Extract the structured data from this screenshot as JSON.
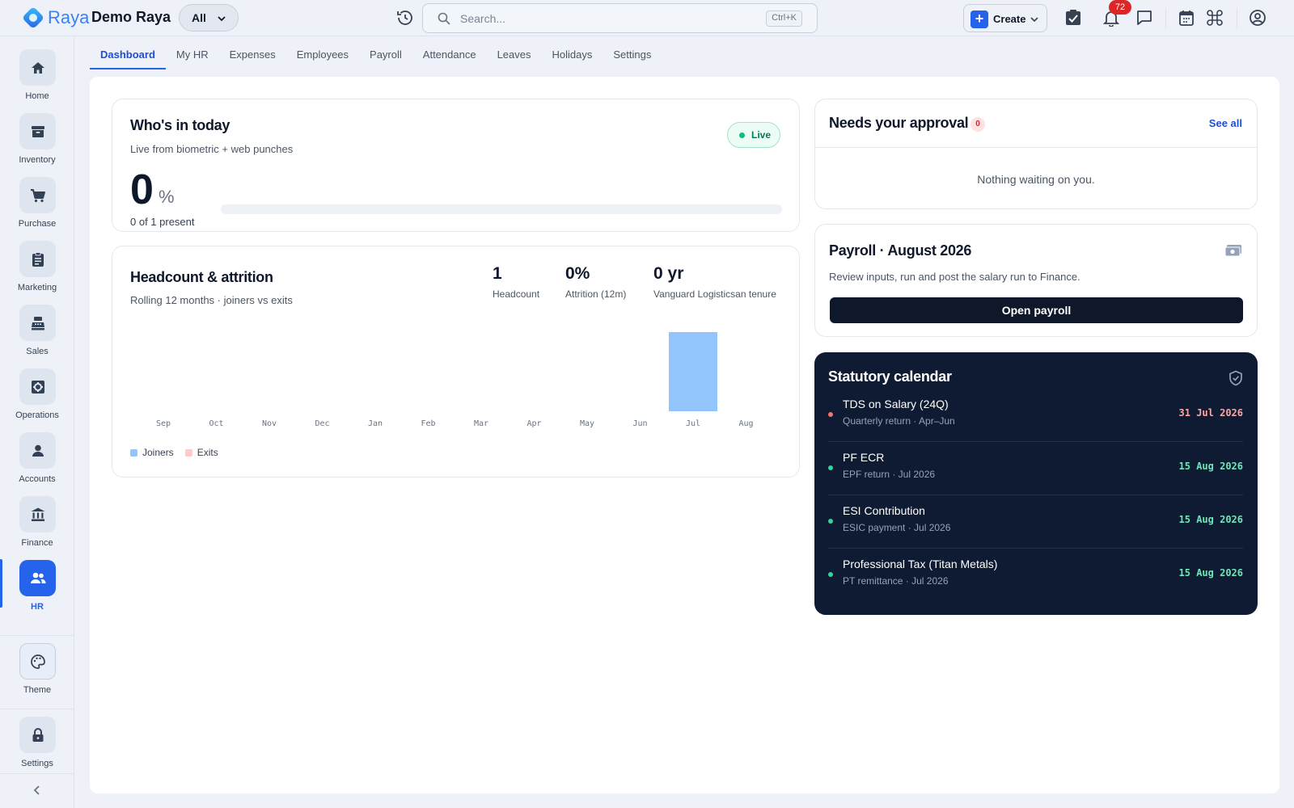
{
  "header": {
    "brand": "Raya",
    "company": "Demo Raya",
    "scope": "All",
    "search_placeholder": "Search...",
    "search_shortcut": "Ctrl+K",
    "create_label": "Create",
    "notification_count": "72"
  },
  "sidebar": {
    "items": [
      {
        "label": "Home",
        "icon": "home-icon"
      },
      {
        "label": "Inventory",
        "icon": "archive-icon"
      },
      {
        "label": "Purchase",
        "icon": "cart-icon"
      },
      {
        "label": "Marketing",
        "icon": "clipboard-icon"
      },
      {
        "label": "Sales",
        "icon": "cash-register-icon"
      },
      {
        "label": "Operations",
        "icon": "cog-icon"
      },
      {
        "label": "Accounts",
        "icon": "user-icon"
      },
      {
        "label": "Finance",
        "icon": "bank-icon"
      },
      {
        "label": "HR",
        "icon": "people-icon"
      }
    ],
    "active": "HR",
    "theme_label": "Theme",
    "settings_label": "Settings"
  },
  "tabs": [
    "Dashboard",
    "My HR",
    "Expenses",
    "Employees",
    "Payroll",
    "Attendance",
    "Leaves",
    "Holidays",
    "Settings"
  ],
  "active_tab": "Dashboard",
  "whos_in": {
    "title": "Who's in today",
    "subtitle": "Live from biometric + web punches",
    "live_label": "Live",
    "percent": "0",
    "percent_sign": "%",
    "present_text": "0 of 1 present",
    "progress_fraction": 0
  },
  "headcount": {
    "title": "Headcount & attrition",
    "subtitle": "Rolling 12 months · joiners vs exits",
    "stats": [
      {
        "value": "1",
        "label": "Headcount"
      },
      {
        "value": "0%",
        "label": "Attrition (12m)"
      },
      {
        "value": "0 yr",
        "label": "Vanguard Logisticsan tenure"
      }
    ],
    "legend": [
      {
        "label": "Joiners",
        "color": "#93c5fd"
      },
      {
        "label": "Exits",
        "color": "#fecaca"
      }
    ]
  },
  "chart_data": {
    "type": "bar",
    "categories": [
      "Sep",
      "Oct",
      "Nov",
      "Dec",
      "Jan",
      "Feb",
      "Mar",
      "Apr",
      "May",
      "Jun",
      "Jul",
      "Aug"
    ],
    "series": [
      {
        "name": "Joiners",
        "values": [
          0,
          0,
          0,
          0,
          0,
          0,
          0,
          0,
          0,
          0,
          1,
          0
        ],
        "color": "#93c5fd"
      },
      {
        "name": "Exits",
        "values": [
          0,
          0,
          0,
          0,
          0,
          0,
          0,
          0,
          0,
          0,
          0,
          0
        ],
        "color": "#fecaca"
      }
    ],
    "ylim": [
      0,
      1
    ],
    "grid": false,
    "legend_position": "bottom-left"
  },
  "approval": {
    "title": "Needs your approval",
    "count": "0",
    "see_all": "See all",
    "empty": "Nothing waiting on you."
  },
  "payroll": {
    "title": "Payroll · August 2026",
    "description": "Review inputs, run and post the salary run to Finance.",
    "button": "Open payroll"
  },
  "statutory": {
    "title": "Statutory calendar",
    "items": [
      {
        "name": "TDS on Salary (24Q)",
        "meta": "Quarterly return · Apr–Jun",
        "date": "31 Jul 2026",
        "status_color": "#f87171",
        "date_color": "#fca5a5"
      },
      {
        "name": "PF ECR",
        "meta": "EPF return · Jul 2026",
        "date": "15 Aug 2026",
        "status_color": "#34d399",
        "date_color": "#6ee7b7"
      },
      {
        "name": "ESI Contribution",
        "meta": "ESIC payment · Jul 2026",
        "date": "15 Aug 2026",
        "status_color": "#34d399",
        "date_color": "#6ee7b7"
      },
      {
        "name": "Professional Tax (Titan Metals)",
        "meta": "PT remittance · Jul 2026",
        "date": "15 Aug 2026",
        "status_color": "#34d399",
        "date_color": "#6ee7b7"
      }
    ]
  }
}
